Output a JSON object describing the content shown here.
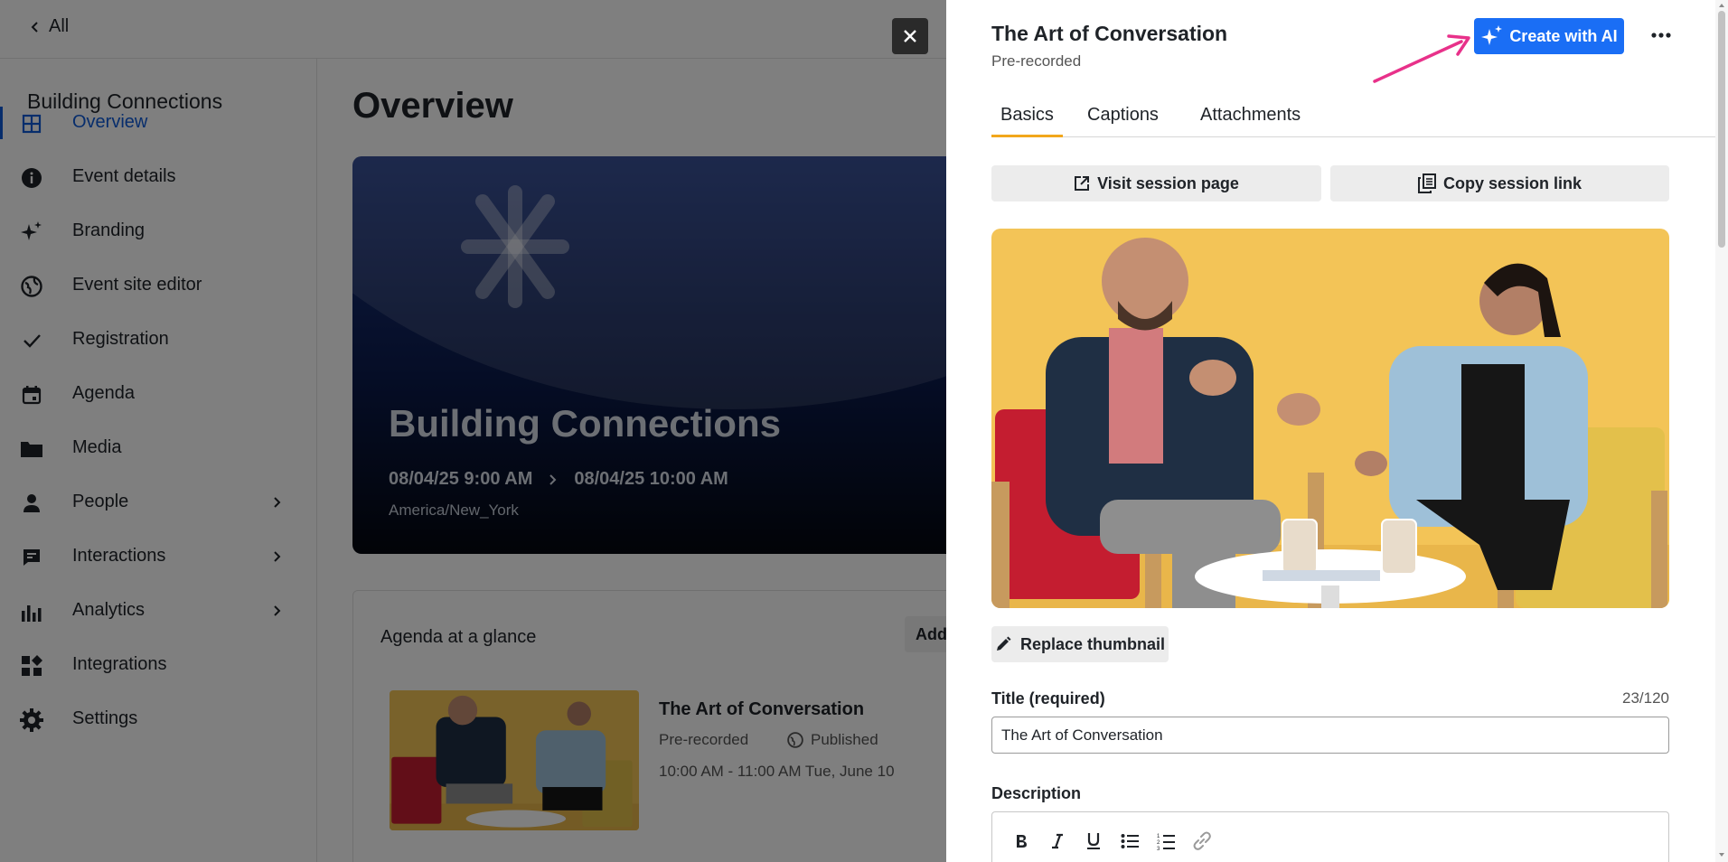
{
  "topbar": {
    "back_label": "All"
  },
  "sidebar": {
    "event_title": "Building Connections",
    "items": [
      {
        "label": "Overview",
        "icon": "grid-icon",
        "active": true,
        "has_submenu": false
      },
      {
        "label": "Event details",
        "icon": "info-icon",
        "active": false,
        "has_submenu": false
      },
      {
        "label": "Branding",
        "icon": "sparkle-icon",
        "active": false,
        "has_submenu": false
      },
      {
        "label": "Event site editor",
        "icon": "globe-icon",
        "active": false,
        "has_submenu": false
      },
      {
        "label": "Registration",
        "icon": "check-icon",
        "active": false,
        "has_submenu": false
      },
      {
        "label": "Agenda",
        "icon": "calendar-icon",
        "active": false,
        "has_submenu": false
      },
      {
        "label": "Media",
        "icon": "folder-icon",
        "active": false,
        "has_submenu": false
      },
      {
        "label": "People",
        "icon": "person-icon",
        "active": false,
        "has_submenu": true
      },
      {
        "label": "Interactions",
        "icon": "chat-icon",
        "active": false,
        "has_submenu": true
      },
      {
        "label": "Analytics",
        "icon": "bar-chart-icon",
        "active": false,
        "has_submenu": true
      },
      {
        "label": "Integrations",
        "icon": "apps-icon",
        "active": false,
        "has_submenu": false
      },
      {
        "label": "Settings",
        "icon": "gear-icon",
        "active": false,
        "has_submenu": false
      }
    ]
  },
  "main": {
    "title": "Overview",
    "hero": {
      "title": "Building Connections",
      "start": "08/04/25 9:00 AM",
      "end": "08/04/25 10:00 AM",
      "timezone": "America/New_York"
    },
    "agenda": {
      "title": "Agenda at a glance",
      "add_label": "Add s",
      "session": {
        "title": "The Art of Conversation",
        "type": "Pre-recorded",
        "status": "Published",
        "time": "10:00 AM - 11:00 AM Tue, June 10"
      }
    }
  },
  "drawer": {
    "title": "The Art of Conversation",
    "subtitle": "Pre-recorded",
    "ai_button": "Create with AI",
    "tabs": [
      "Basics",
      "Captions",
      "Attachments"
    ],
    "active_tab": "Basics",
    "visit_label": "Visit session page",
    "copy_label": "Copy session link",
    "replace_label": "Replace thumbnail",
    "title_field": {
      "label": "Title (required)",
      "count": "23/120",
      "value": "The Art of Conversation"
    },
    "description_label": "Description",
    "toolbar": [
      "bold-icon",
      "italic-icon",
      "underline-icon",
      "bulleted-list-icon",
      "numbered-list-icon",
      "link-icon"
    ]
  },
  "colors": {
    "accent": "#1a6ef5",
    "active_nav": "#0f5bd8",
    "tab_underline": "#f2a71c",
    "annotation_arrow": "#e8318a",
    "backdrop_yellow": "#f3c457"
  }
}
